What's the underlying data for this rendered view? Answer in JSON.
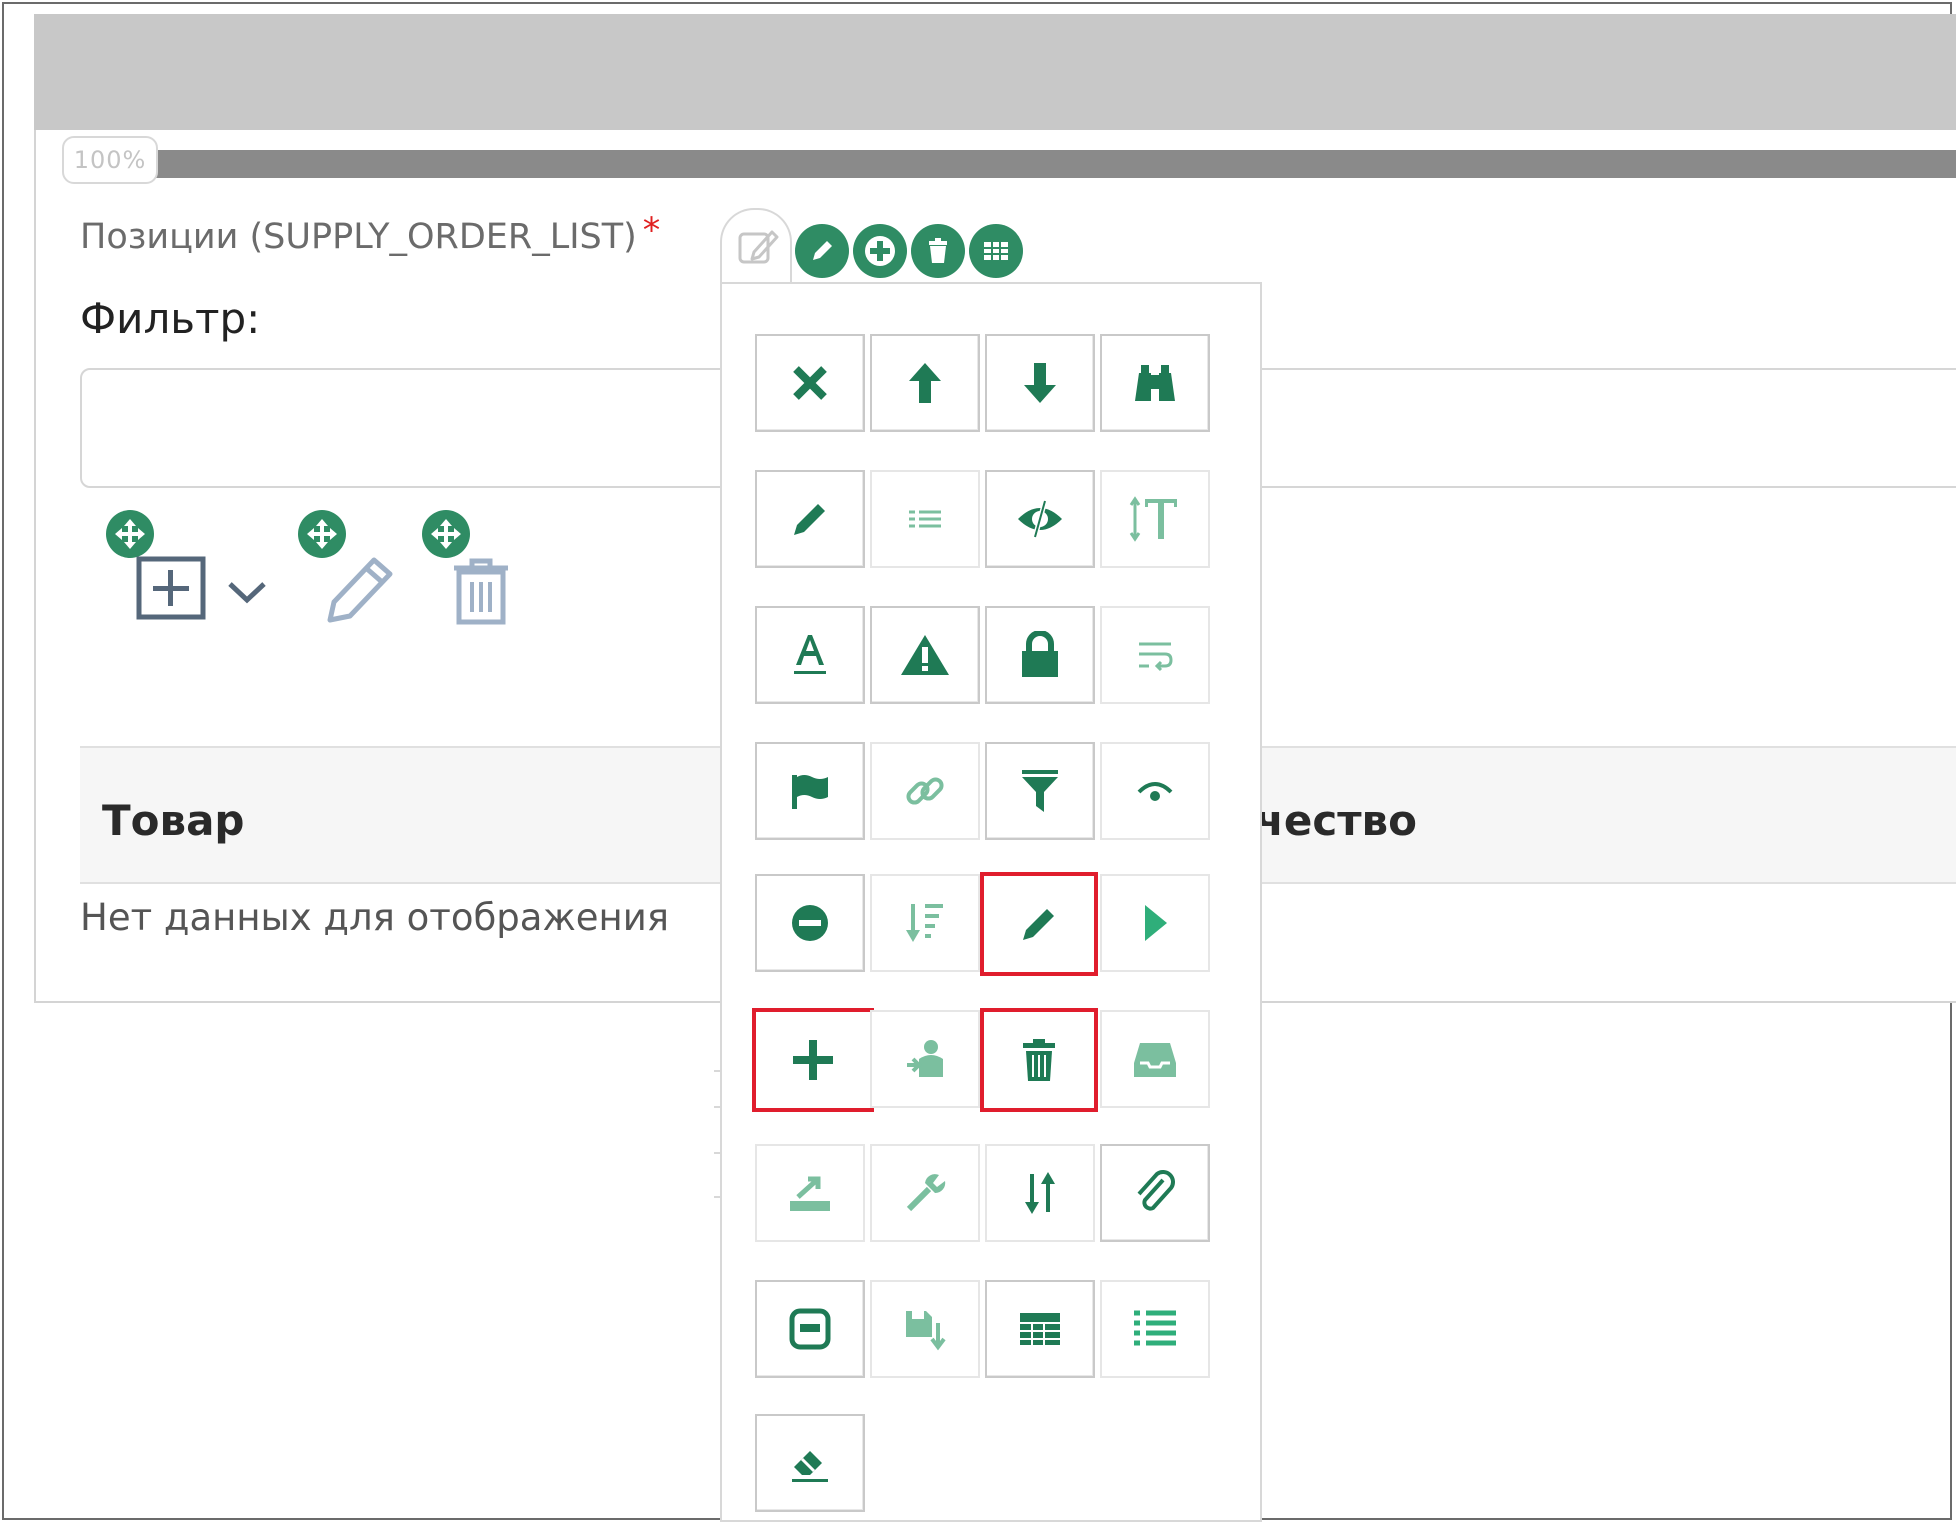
{
  "progress": {
    "label": "100%",
    "value_percent": 100
  },
  "field": {
    "label": "Позиции (SUPPLY_ORDER_LIST)",
    "required_mark": "*"
  },
  "filter": {
    "label": "Фильтр:",
    "value": ""
  },
  "table": {
    "columns": [
      "Товар",
      "чество"
    ],
    "empty_text": "Нет данных для отображения"
  },
  "colors": {
    "accent": "#2f8c64",
    "accent_light": "#7bbf9f",
    "highlight": "#e01d2d",
    "topbar": "#c8c8c8"
  },
  "quick_actions": [
    "pencil-icon",
    "plus-icon",
    "trash-icon",
    "grid-icon"
  ],
  "toolbar_icons": [
    "add-box-icon",
    "chevron-down-icon",
    "pencil-outline-icon",
    "trash-outline-icon"
  ],
  "menu_icons": [
    [
      "close-icon",
      "arrow-up-icon",
      "arrow-down-icon",
      "binoculars-icon"
    ],
    [
      "pencil-icon",
      "list-lines-icon",
      "eye-slash-icon",
      "text-height-icon"
    ],
    [
      "font-underline-icon",
      "warning-icon",
      "lock-icon",
      "wrap-text-icon"
    ],
    [
      "flag-icon",
      "link-icon",
      "filter-icon",
      "signal-icon"
    ],
    [
      "minus-circle-icon",
      "sort-desc-icon",
      "pencil-icon",
      "play-icon"
    ],
    [
      "plus-icon",
      "user-export-icon",
      "trash-icon",
      "inbox-icon"
    ],
    [
      "upload-icon",
      "wrench-icon",
      "sort-icon",
      "paperclip-icon"
    ],
    [
      "square-minus-icon",
      "save-icon",
      "table-icon",
      "list-icon"
    ],
    [
      "eraser-icon"
    ]
  ]
}
